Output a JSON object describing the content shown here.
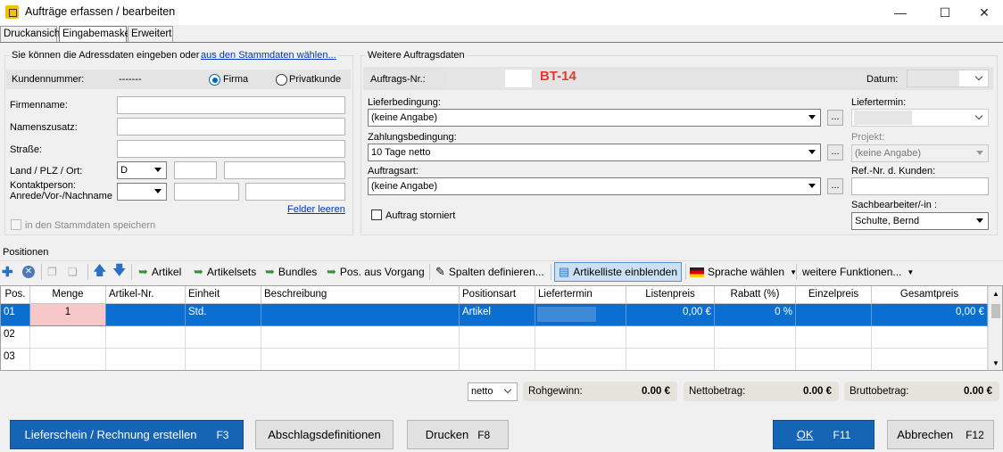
{
  "window": {
    "title": "Aufträge erfassen / bearbeiten",
    "minimize": "—",
    "maximize": "☐",
    "close": "✕"
  },
  "tabs": [
    "Druckansicht",
    "Eingabemaske",
    "Erweitert"
  ],
  "address": {
    "intro": "Sie können die Adressdaten eingeben oder",
    "intro_link": "aus den Stammdaten wählen...",
    "customer_no_label": "Kundennummer:",
    "customer_no_value": "-------",
    "radio_firma": "Firma",
    "radio_privat": "Privatkunde",
    "firmenname": "Firmenname:",
    "namenszusatz": "Namenszusatz:",
    "strasse": "Straße:",
    "land_plz_ort": "Land / PLZ / Ort:",
    "land_value": "D",
    "kontakt_1": "Kontaktperson:",
    "kontakt_2": "Anrede/Vor-/Nachname",
    "clear_link": "Felder leeren",
    "save_checkbox": "in den Stammdaten speichern"
  },
  "order": {
    "group_title": "Weitere Auftragsdaten",
    "order_no_label": "Auftrags-Nr.:",
    "order_no_tag": "BT-14",
    "date_label": "Datum:",
    "lieferbedingung_label": "Lieferbedingung:",
    "lieferbedingung_value": "(keine Angabe)",
    "zahlungsbedingung_label": "Zahlungsbedingung:",
    "zahlungsbedingung_value": "10 Tage netto",
    "auftragsart_label": "Auftragsart:",
    "auftragsart_value": "(keine Angabe)",
    "storniert_label": "Auftrag storniert",
    "liefertermin_label": "Liefertermin:",
    "projekt_label": "Projekt:",
    "projekt_value": "(keine Angabe)",
    "refnr_label": "Ref.-Nr. d. Kunden:",
    "sachbearbeiter_label": "Sachbearbeiter/-in :",
    "sachbearbeiter_value": "Schulte, Bernd",
    "dots": "..."
  },
  "positions": {
    "section_label": "Positionen",
    "toolbar": {
      "artikel": "Artikel",
      "artikelsets": "Artikelsets",
      "bundles": "Bundles",
      "pos_aus_vorgang": "Pos. aus Vorgang",
      "spalten": "Spalten definieren...",
      "artikelliste": "Artikelliste einblenden",
      "sprache": "Sprache wählen",
      "weitere": "weitere Funktionen..."
    },
    "columns": [
      "Pos.",
      "Menge",
      "Artikel-Nr.",
      "Einheit",
      "Beschreibung",
      "Positionsart",
      "Liefertermin",
      "Listenpreis",
      "Rabatt (%)",
      "Einzelpreis",
      "Gesamtpreis"
    ],
    "rows": [
      {
        "pos": "01",
        "menge": "1",
        "artikelnr": "",
        "einheit": "Std.",
        "beschreibung": "",
        "positionsart": "Artikel",
        "liefertermin": "",
        "listenpreis": "0,00 €",
        "rabatt": "0 %",
        "einzelpreis": "",
        "gesamtpreis": "0,00 €"
      },
      {
        "pos": "02"
      },
      {
        "pos": "03"
      }
    ]
  },
  "totals": {
    "mode": "netto",
    "rohgewinn_label": "Rohgewinn:",
    "rohgewinn_value": "0.00 €",
    "netto_label": "Nettobetrag:",
    "netto_value": "0.00 €",
    "brutto_label": "Bruttobetrag:",
    "brutto_value": "0.00 €"
  },
  "buttons": {
    "lieferschein": "Lieferschein / Rechnung erstellen",
    "lieferschein_key": "F3",
    "abschlag": "Abschlagsdefinitionen",
    "drucken": "Drucken",
    "drucken_key": "F8",
    "ok": "OK",
    "ok_key": "F11",
    "abbrechen": "Abbrechen",
    "abbrechen_key": "F12"
  },
  "colors": {
    "accent": "#1565b4",
    "selection": "#0a6fd1",
    "tag": "#e53935",
    "qty_cell": "#f8c8c8"
  }
}
